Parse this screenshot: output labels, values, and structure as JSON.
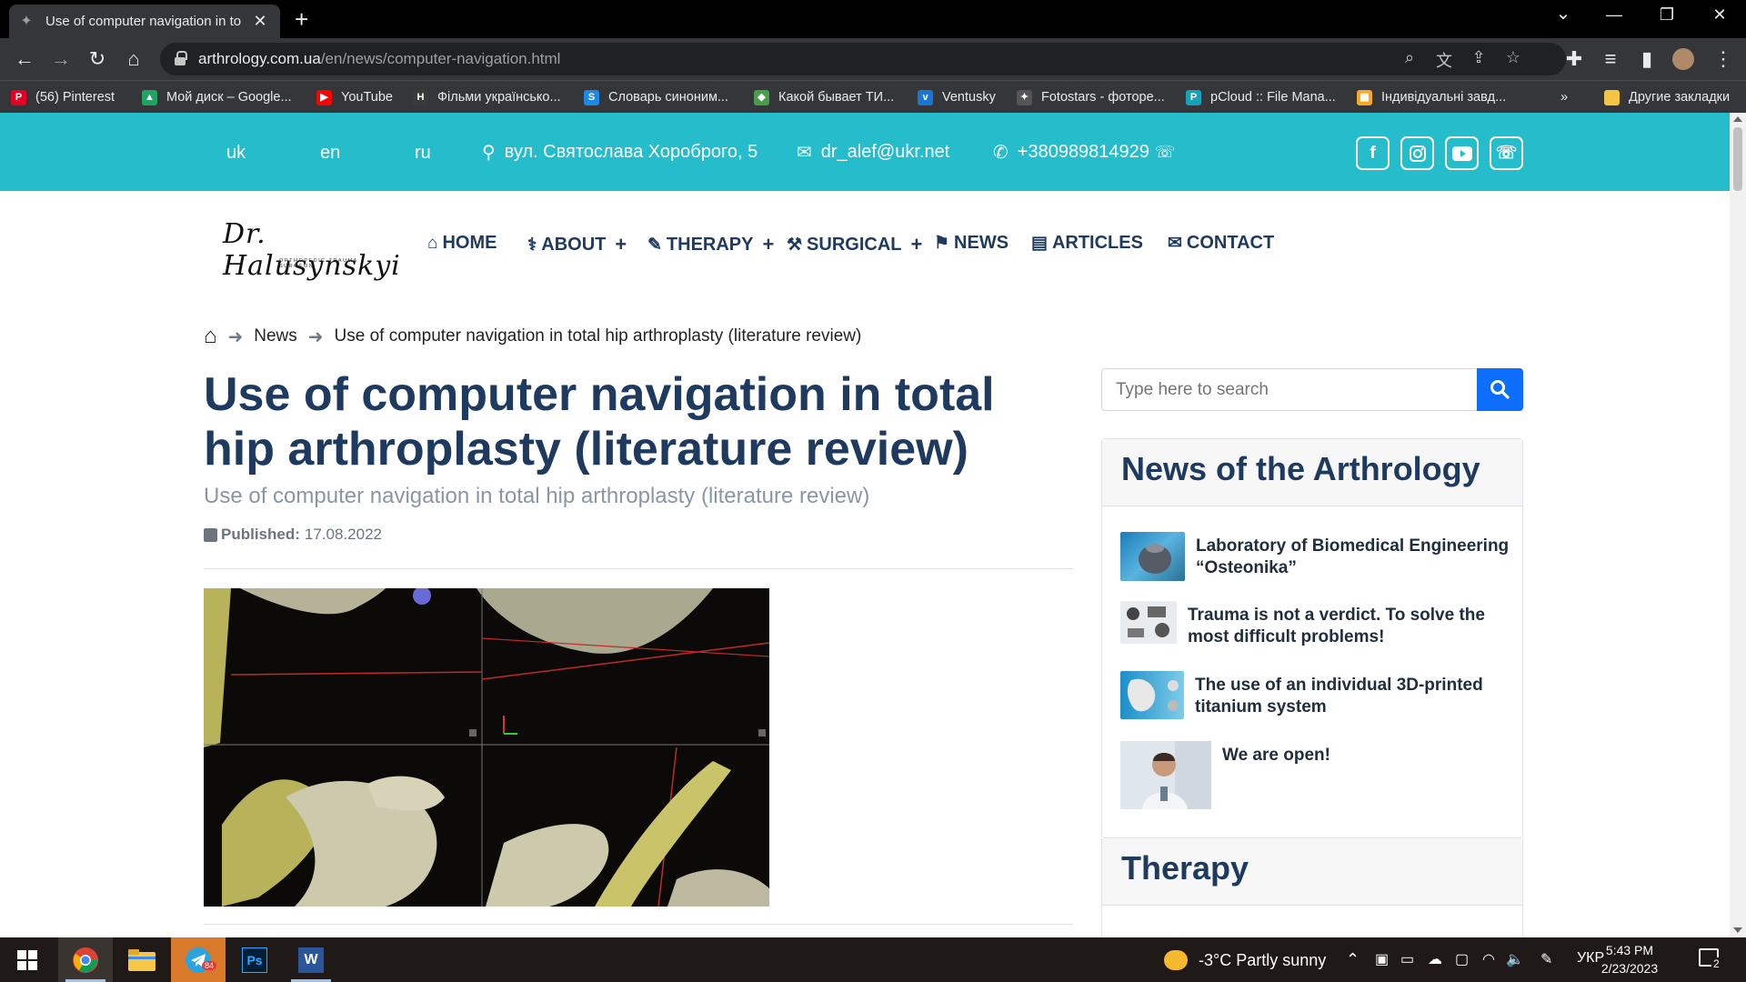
{
  "browser": {
    "tab_title": "Use of computer navigation in to",
    "url_domain": "arthrology.com.ua",
    "url_path": "/en/news/computer-navigation.html",
    "bookmarks": [
      {
        "label": "(56) Pinterest",
        "color": "#e60023",
        "glyph": "P"
      },
      {
        "label": "Мой диск – Google...",
        "color": "#1fa463",
        "glyph": "▲"
      },
      {
        "label": "YouTube",
        "color": "#ff0000",
        "glyph": "▶"
      },
      {
        "label": "Фільми українсько...",
        "color": "#3a3a3a",
        "glyph": "H"
      },
      {
        "label": "Словарь синоним...",
        "color": "#1e88e5",
        "glyph": "S"
      },
      {
        "label": "Какой бывает ТИ...",
        "color": "#43a047",
        "glyph": "◆"
      },
      {
        "label": "Ventusky",
        "color": "#1976d2",
        "glyph": "v"
      },
      {
        "label": "Fotostars - фоторе...",
        "color": "#555",
        "glyph": "✦"
      },
      {
        "label": "pCloud :: File Mana...",
        "color": "#17a2b8",
        "glyph": "P"
      },
      {
        "label": "Індивідуальні завд...",
        "color": "#f9a825",
        "glyph": "▦"
      }
    ],
    "other_bookmarks": "Другие закладки",
    "more": "»"
  },
  "topbar": {
    "langs": [
      "uk",
      "en",
      "ru"
    ],
    "address": "вул. Святослава Хороброго, 5",
    "email": "dr_alef@ukr.net",
    "phone": "+380989814929"
  },
  "logo": {
    "text": "Dr. Halusynskyi",
    "subtitle": "ORTHOPEDIC TRAUMA SURGEON"
  },
  "nav": [
    {
      "label": "HOME",
      "icon": "home-icon"
    },
    {
      "label": "ABOUT",
      "icon": "stethoscope-icon",
      "plus": "+"
    },
    {
      "label": "THERAPY",
      "icon": "syringe-icon",
      "plus": "+"
    },
    {
      "label": "SURGICAL",
      "icon": "scalpel-icon",
      "plus": "+"
    },
    {
      "label": "NEWS",
      "icon": "flag-icon"
    },
    {
      "label": "ARTICLES",
      "icon": "newspaper-icon"
    },
    {
      "label": "CONTACT",
      "icon": "envelope-icon"
    }
  ],
  "breadcrumb": {
    "items": [
      "News",
      "Use of computer navigation in total hip arthroplasty (literature review)"
    ]
  },
  "article": {
    "title": "Use of computer navigation in total hip arthroplasty (literature review)",
    "subtitle": "Use of computer navigation in total hip arthroplasty (literature review)",
    "published_label": "Published:",
    "published_date": "17.08.2022"
  },
  "sidebar": {
    "search_placeholder": "Type here to search",
    "news_heading": "News of the Arthrology",
    "news": [
      "Laboratory of Biomedical Engineering “Osteonika”",
      "Trauma is not a verdict. To solve the most difficult problems!",
      "The use of an individual 3D-printed titanium system",
      "We are open!"
    ],
    "therapy_heading": "Therapy"
  },
  "taskbar": {
    "weather": "-3°C  Partly sunny",
    "lang": "УКР",
    "time": "5:43 PM",
    "date": "2/23/2023",
    "telegram_badge": "84",
    "notif_count": "2"
  },
  "colors": {
    "topbar": "#25bccc",
    "heading": "#1f3a5f",
    "search_btn": "#0d6efd"
  }
}
